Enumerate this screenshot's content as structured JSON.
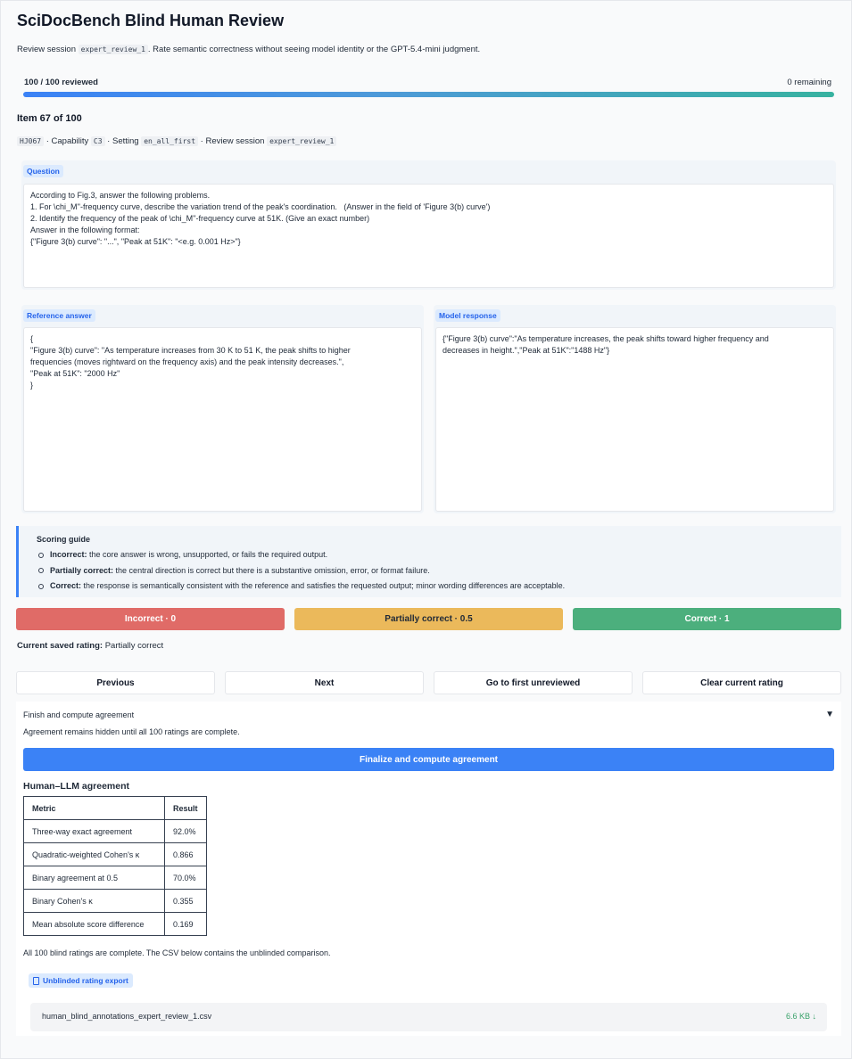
{
  "header": {
    "title": "SciDocBench Blind Human Review",
    "subtitle_prefix": "Review session ",
    "subtitle_session": "expert_review_1",
    "subtitle_suffix": ". Rate semantic correctness without seeing model identity or the GPT-5.4-mini judgment."
  },
  "progress": {
    "reviewed_label": "100 / 100 reviewed",
    "remaining_label": "0 remaining",
    "fraction": 1.0
  },
  "item": {
    "title": "Item 67 of 100",
    "id": "HJ067",
    "capability_label": " · Capability ",
    "capability": "C3",
    "setting_label": " · Setting ",
    "setting": "en_all_first",
    "session_label": " · Review session ",
    "session": "expert_review_1"
  },
  "question": {
    "tag": "Question",
    "text": "According to Fig.3, answer the following problems.\n1. For \\chi_M''-frequency curve, describe the variation trend of the peak's coordination.   (Answer in the field of 'Figure 3(b) curve')\n2. Identify the frequency of the peak of \\chi_M''-frequency curve at 51K. (Give an exact number)\nAnswer in the following format:\n{\"Figure 3(b) curve\": \"...\", \"Peak at 51K\": \"<e.g. 0.001 Hz>\"}"
  },
  "reference": {
    "tag": "Reference answer",
    "text": "{\n\"Figure 3(b) curve\": \"As temperature increases from 30 K to 51 K, the peak shifts to higher\nfrequencies (moves rightward on the frequency axis) and the peak intensity decreases.\",\n\"Peak at 51K\": \"2000 Hz\"\n}"
  },
  "model": {
    "tag": "Model response",
    "text": "{\"Figure 3(b) curve\":\"As temperature increases, the peak shifts toward higher frequency and\ndecreases in height.\",\"Peak at 51K\":\"1488 Hz\"}"
  },
  "guide": {
    "title": "Scoring guide",
    "items": [
      {
        "label": "Incorrect:",
        "text": " the core answer is wrong, unsupported, or fails the required output."
      },
      {
        "label": "Partially correct:",
        "text": " the central direction is correct but there is a substantive omission, error, or format failure."
      },
      {
        "label": "Correct:",
        "text": " the response is semantically consistent with the reference and satisfies the requested output; minor wording differences are acceptable."
      }
    ]
  },
  "rating": {
    "incorrect": "Incorrect · 0",
    "partial": "Partially correct · 0.5",
    "correct": "Correct · 1",
    "saved_label": "Current saved rating:",
    "saved_value": " Partially correct"
  },
  "nav": {
    "previous": "Previous",
    "next": "Next",
    "first_unreviewed": "Go to first unreviewed",
    "clear": "Clear current rating"
  },
  "finish": {
    "summary": "Finish and compute agreement",
    "arrow": "▼",
    "note": "Agreement remains hidden until all 100 ratings are complete.",
    "button": "Finalize and compute agreement",
    "agreement_title": "Human–LLM agreement",
    "table": {
      "headers": [
        "Metric",
        "Result"
      ],
      "rows": [
        [
          "Three-way exact agreement",
          "92.0%"
        ],
        [
          "Quadratic-weighted Cohen's κ",
          "0.866"
        ],
        [
          "Binary agreement at 0.5",
          "70.0%"
        ],
        [
          "Binary Cohen's κ",
          "0.355"
        ],
        [
          "Mean absolute score difference",
          "0.169"
        ]
      ]
    },
    "complete_note": "All 100 blind ratings are complete. The CSV below contains the unblinded comparison.",
    "export_tag": "Unblinded rating export",
    "file_name": "human_blind_annotations_expert_review_1.csv",
    "file_size": "6.6 KB ↓"
  }
}
